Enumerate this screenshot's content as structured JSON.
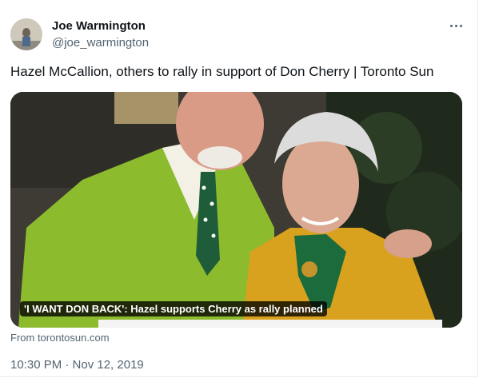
{
  "author": {
    "display_name": "Joe Warmington",
    "handle": "@joe_warmington",
    "avatar_icon": "profile-photo"
  },
  "menu": {
    "icon": "more-horizontal-icon"
  },
  "tweet": {
    "text": "Hazel McCallion, others to rally in support of Don Cherry | Toronto Sun"
  },
  "card": {
    "caption": "'I WANT DON BACK': Hazel supports Cherry as rally planned",
    "source": "From torontosun.com"
  },
  "meta": {
    "timestamp": "10:30 PM · Nov 12, 2019"
  },
  "colors": {
    "primary_text": "#0f1419",
    "secondary_text": "#536471",
    "suit_green": "#8dbb2e",
    "jacket_gold": "#d9a21e"
  }
}
